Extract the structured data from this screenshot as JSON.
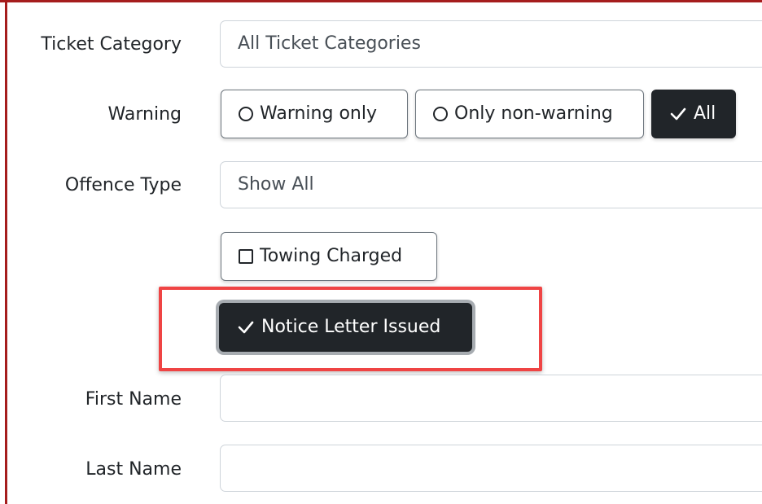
{
  "form": {
    "ticket_category": {
      "label": "Ticket Category",
      "value": "All Ticket Categories"
    },
    "warning": {
      "label": "Warning",
      "options": [
        {
          "label": "Warning only",
          "selected": false
        },
        {
          "label": "Only non-warning",
          "selected": false
        },
        {
          "label": "All",
          "selected": true
        }
      ]
    },
    "offence_type": {
      "label": "Offence Type",
      "value": "Show All"
    },
    "towing_charged": {
      "label": "Towing Charged",
      "checked": false
    },
    "notice_letter_issued": {
      "label": "Notice Letter Issued",
      "checked": true
    },
    "first_name": {
      "label": "First Name",
      "value": ""
    },
    "last_name": {
      "label": "Last Name",
      "value": ""
    }
  },
  "colors": {
    "frame": "#a51d1d",
    "highlight": "#ef4444",
    "active_button": "#212529"
  },
  "icons": {
    "radio": "radio-empty-icon",
    "checkbox": "checkbox-empty-icon",
    "check": "checkmark-icon"
  }
}
